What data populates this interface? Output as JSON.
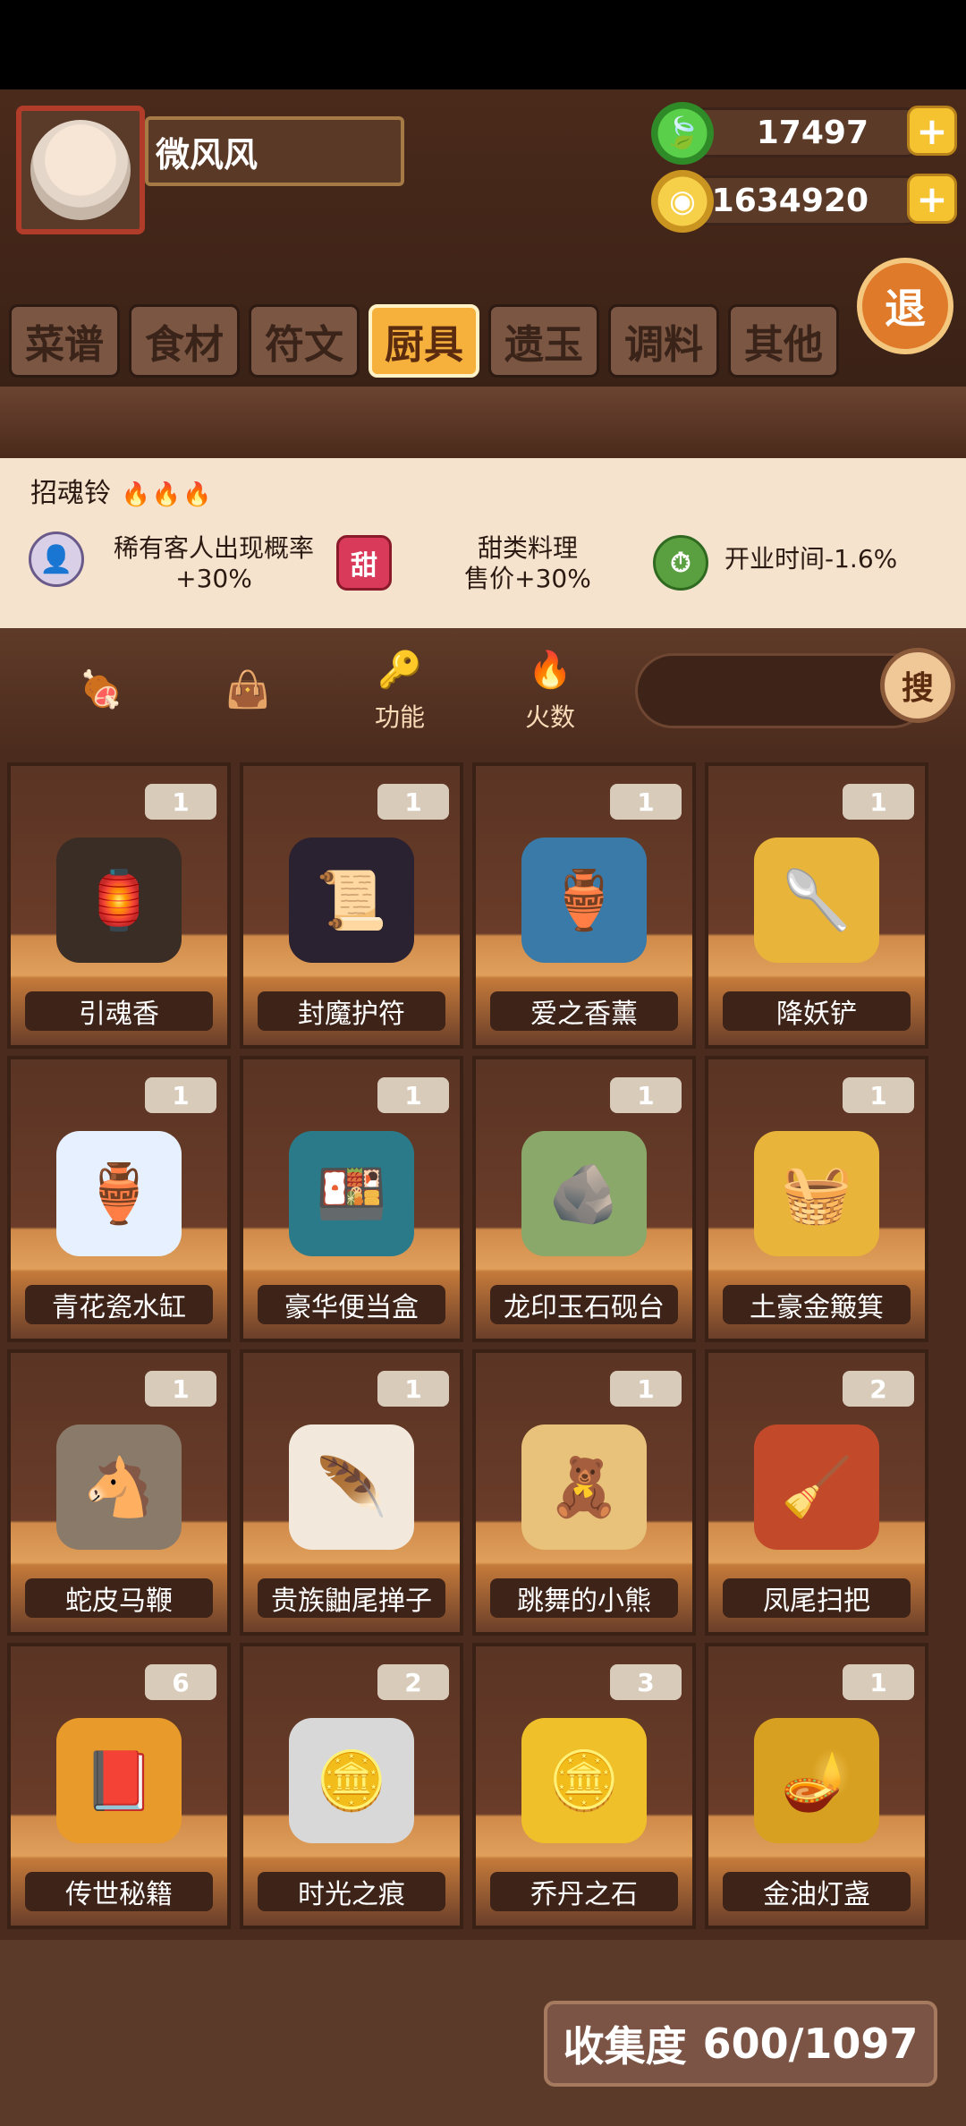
{
  "player": {
    "name": "微风风"
  },
  "currencies": {
    "gems": "17497",
    "coins": "1634920"
  },
  "buttons": {
    "exit": "退",
    "search": "搜",
    "plus": "+"
  },
  "tabs": [
    "菜谱",
    "食材",
    "符文",
    "厨具",
    "遗玉",
    "调料",
    "其他"
  ],
  "active_tab_index": 3,
  "selected_item": {
    "name": "招魂铃",
    "fire_level": 3,
    "effects": [
      {
        "text_line1": "稀有客人出现概率",
        "text_line2": "+30%",
        "icon": "rare-guest-icon"
      },
      {
        "text_line1": "甜类料理",
        "text_line2": "售价+30%",
        "icon": "sweet-icon",
        "icon_text": "甜"
      },
      {
        "text_line1": "开业时间-1.6%",
        "text_line2": "",
        "icon": "clock-icon"
      }
    ]
  },
  "filters": [
    {
      "label": "",
      "icon": "meat-icon"
    },
    {
      "label": "",
      "icon": "bag-icon"
    },
    {
      "label": "功能",
      "icon": "key-icon"
    },
    {
      "label": "火数",
      "icon": "fire-icon"
    }
  ],
  "items": [
    {
      "name": "引魂香",
      "count": "1",
      "icon": "lantern-icon"
    },
    {
      "name": "封魔护符",
      "count": "1",
      "icon": "talisman-icon"
    },
    {
      "name": "爱之香薰",
      "count": "1",
      "icon": "incense-icon"
    },
    {
      "name": "降妖铲",
      "count": "1",
      "icon": "spatula-icon"
    },
    {
      "name": "青花瓷水缸",
      "count": "1",
      "icon": "porcelain-jar-icon"
    },
    {
      "name": "豪华便当盒",
      "count": "1",
      "icon": "bento-box-icon"
    },
    {
      "name": "龙印玉石砚台",
      "count": "1",
      "icon": "inkstone-icon"
    },
    {
      "name": "土豪金簸箕",
      "count": "1",
      "icon": "dustpan-icon"
    },
    {
      "name": "蛇皮马鞭",
      "count": "1",
      "icon": "whip-icon"
    },
    {
      "name": "贵族鼬尾掸子",
      "count": "1",
      "icon": "duster-icon"
    },
    {
      "name": "跳舞的小熊",
      "count": "1",
      "icon": "bear-broom-icon"
    },
    {
      "name": "凤尾扫把",
      "count": "2",
      "icon": "phoenix-broom-icon"
    },
    {
      "name": "传世秘籍",
      "count": "6",
      "icon": "secret-book-icon"
    },
    {
      "name": "时光之痕",
      "count": "2",
      "icon": "silver-coin-icon"
    },
    {
      "name": "乔丹之石",
      "count": "3",
      "icon": "gold-coin-icon"
    },
    {
      "name": "金油灯盏",
      "count": "1",
      "icon": "oil-lamp-icon"
    }
  ],
  "collection": {
    "label": "收集度",
    "value": "600/1097"
  }
}
